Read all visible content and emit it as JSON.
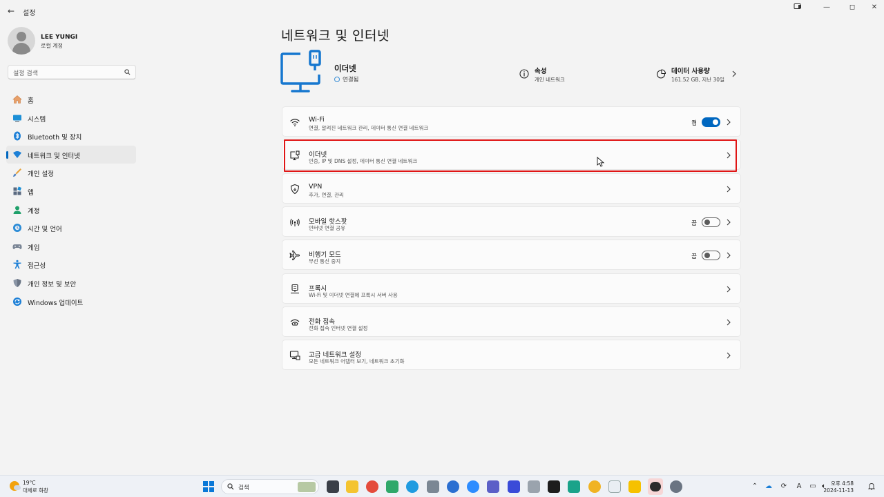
{
  "window": {
    "title": "설정",
    "back_glyph": "←",
    "minimize_glyph": "—",
    "maximize_glyph": "◻",
    "close_glyph": "✕"
  },
  "profile": {
    "name": "LEE YUNGI",
    "account_type": "로컬 계정"
  },
  "search": {
    "placeholder": "설정 검색"
  },
  "sidebar": {
    "items": [
      {
        "label": "홈",
        "icon": "home-icon"
      },
      {
        "label": "시스템",
        "icon": "system-icon"
      },
      {
        "label": "Bluetooth 및 장치",
        "icon": "bluetooth-icon"
      },
      {
        "label": "네트워크 및 인터넷",
        "icon": "network-icon",
        "selected": true
      },
      {
        "label": "개인 설정",
        "icon": "personalization-icon"
      },
      {
        "label": "앱",
        "icon": "apps-icon"
      },
      {
        "label": "계정",
        "icon": "accounts-icon"
      },
      {
        "label": "시간 및 언어",
        "icon": "time-language-icon"
      },
      {
        "label": "게임",
        "icon": "gaming-icon"
      },
      {
        "label": "접근성",
        "icon": "accessibility-icon"
      },
      {
        "label": "개인 정보 및 보안",
        "icon": "privacy-shield-icon"
      },
      {
        "label": "Windows 업데이트",
        "icon": "windows-update-icon"
      }
    ]
  },
  "main": {
    "title": "네트워크 및 인터넷",
    "hero": {
      "name": "이더넷",
      "status": "연결됨",
      "properties": {
        "title": "속성",
        "subtitle": "개인 네트워크"
      },
      "data_usage": {
        "title": "데이터 사용량",
        "subtitle": "161.52 GB, 지난 30일"
      }
    },
    "cards": [
      {
        "title": "Wi-Fi",
        "desc": "연결, 알려진 네트워크 관리, 데이터 통신 연결 네트워크",
        "icon": "wifi-icon",
        "toggle_label": "켬",
        "toggle_on": true
      },
      {
        "title": "이더넷",
        "desc": "인증, IP 및 DNS 설정, 데이터 통신 연결 네트워크",
        "icon": "ethernet-icon",
        "highlighted": true
      },
      {
        "title": "VPN",
        "desc": "추가, 연결, 관리",
        "icon": "vpn-shield-icon"
      },
      {
        "title": "모바일 핫스팟",
        "desc": "인터넷 연결 공유",
        "icon": "hotspot-icon",
        "toggle_label": "끔",
        "toggle_on": false
      },
      {
        "title": "비행기 모드",
        "desc": "무선 통신 중지",
        "icon": "airplane-icon",
        "toggle_label": "끔",
        "toggle_on": false
      },
      {
        "title": "프록시",
        "desc": "Wi-Fi 및 이더넷 연결에 프록시 서버 사용",
        "icon": "proxy-icon"
      },
      {
        "title": "전화 접속",
        "desc": "전화 접속 인터넷 연결 설정",
        "icon": "dialup-icon"
      },
      {
        "title": "고급 네트워크 설정",
        "desc": "모든 네트워크 어댑터 보기, 네트워크 초기화",
        "icon": "advanced-network-icon"
      }
    ]
  },
  "taskbar": {
    "weather": {
      "temp": "19°C",
      "desc": "대체로 화창"
    },
    "search_label": "검색",
    "clock": {
      "time": "오후 4:58",
      "date": "2024-11-13"
    },
    "tray_ime": "A",
    "colors": {
      "accent": "#0067c0",
      "highlight": "#e01515"
    }
  }
}
